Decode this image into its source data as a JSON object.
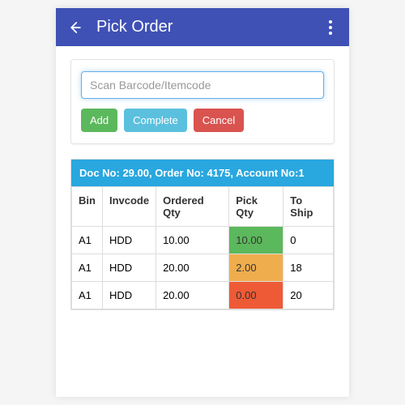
{
  "appbar": {
    "title": "Pick Order"
  },
  "scan": {
    "placeholder": "Scan Barcode/Itemcode"
  },
  "buttons": {
    "add": "Add",
    "complete": "Complete",
    "cancel": "Cancel"
  },
  "doc": {
    "header": "Doc No: 29.00, Order No: 4175, Account No:1"
  },
  "table": {
    "headers": {
      "bin": "Bin",
      "invcode": "Invcode",
      "ordered": "Ordered Qty",
      "pick": "Pick Qty",
      "toship": "To Ship"
    },
    "rows": [
      {
        "bin": "A1",
        "invcode": "HDD",
        "ordered": "10.00",
        "pick": "10.00",
        "pick_class": "pick-green",
        "toship": "0"
      },
      {
        "bin": "A1",
        "invcode": "HDD",
        "ordered": "20.00",
        "pick": "2.00",
        "pick_class": "pick-orange",
        "toship": "18"
      },
      {
        "bin": "A1",
        "invcode": "HDD",
        "ordered": "20.00",
        "pick": "0.00",
        "pick_class": "pick-red",
        "toship": "20"
      }
    ]
  }
}
